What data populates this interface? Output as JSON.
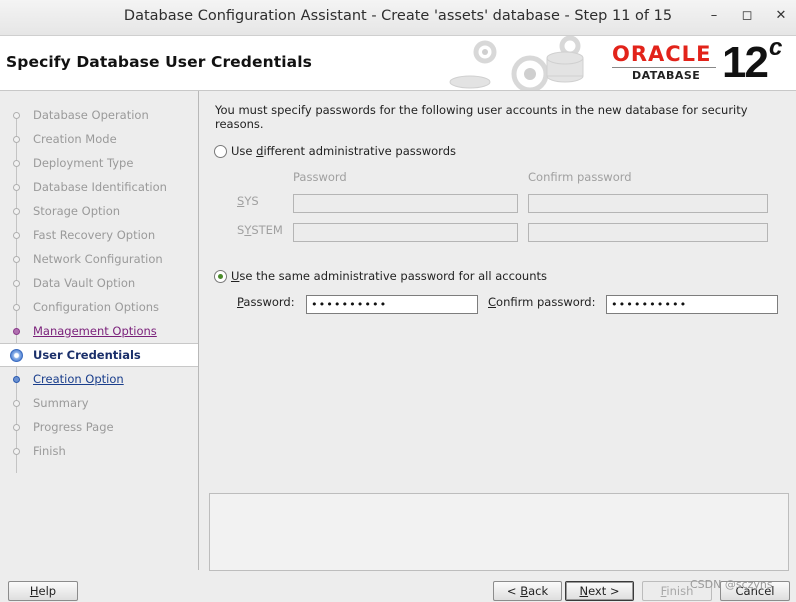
{
  "window": {
    "title": "Database Configuration Assistant - Create 'assets' database - Step 11 of 15",
    "minimize_glyph": "–",
    "maximize_glyph": "◻",
    "close_glyph": "✕"
  },
  "header": {
    "page_title": "Specify Database User Credentials",
    "brand": "ORACLE",
    "brand_sub": "DATABASE",
    "version": "12",
    "version_suffix": "c",
    "brand_color": "#e2231a"
  },
  "steps": [
    {
      "label": "Database Operation",
      "state": "disabled"
    },
    {
      "label": "Creation Mode",
      "state": "disabled"
    },
    {
      "label": "Deployment Type",
      "state": "disabled"
    },
    {
      "label": "Database Identification",
      "state": "disabled"
    },
    {
      "label": "Storage Option",
      "state": "disabled"
    },
    {
      "label": "Fast Recovery Option",
      "state": "disabled"
    },
    {
      "label": "Network Configuration",
      "state": "disabled"
    },
    {
      "label": "Data Vault Option",
      "state": "disabled"
    },
    {
      "label": "Configuration Options",
      "state": "disabled"
    },
    {
      "label": "Management Options",
      "state": "visited"
    },
    {
      "label": "User Credentials",
      "state": "current"
    },
    {
      "label": "Creation Option",
      "state": "link"
    },
    {
      "label": "Summary",
      "state": "disabled"
    },
    {
      "label": "Progress Page",
      "state": "disabled"
    },
    {
      "label": "Finish",
      "state": "disabled"
    }
  ],
  "main": {
    "intro": "You must specify passwords for the following user accounts in the new database for security reasons.",
    "option_different": {
      "pre": "Use ",
      "mnemonic": "d",
      "post": "ifferent administrative passwords",
      "checked": false
    },
    "col_password": "Password",
    "col_confirm": "Confirm password",
    "row_sys": {
      "pre": "",
      "mnemonic": "S",
      "post": "YS"
    },
    "row_system": {
      "pre": "S",
      "mnemonic": "Y",
      "post": "STEM"
    },
    "option_same": {
      "pre": "",
      "mnemonic": "U",
      "post": "se the same administrative password for all accounts",
      "checked": true
    },
    "password_label": {
      "pre": "",
      "mnemonic": "P",
      "post": "assword:"
    },
    "password_value": "••••••••••",
    "confirm_label": {
      "pre": "",
      "mnemonic": "C",
      "post": "onfirm password:"
    },
    "confirm_value": "••••••••••"
  },
  "footer": {
    "help": {
      "pre": "",
      "mnemonic": "H",
      "post": "elp"
    },
    "back": {
      "pre": "< ",
      "mnemonic": "B",
      "post": "ack"
    },
    "next": {
      "pre": "",
      "mnemonic": "N",
      "post": "ext >"
    },
    "finish": {
      "pre": "",
      "mnemonic": "F",
      "post": "inish"
    },
    "cancel": {
      "pre": "",
      "mnemonic": "",
      "post": "Cancel"
    },
    "watermark": "CSDN @sczyns"
  }
}
